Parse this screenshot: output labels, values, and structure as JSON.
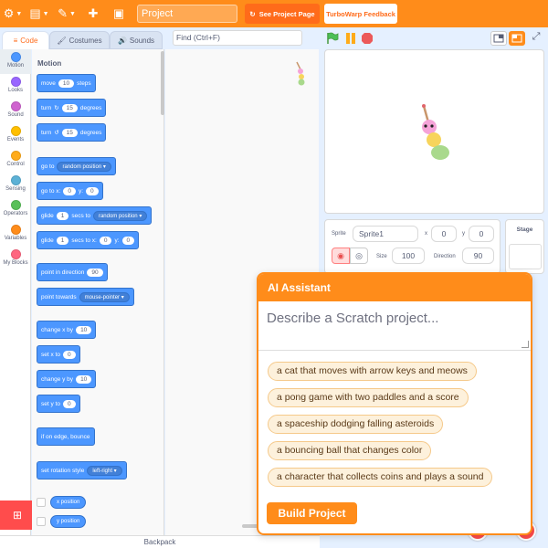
{
  "menubar": {
    "project_title": "Project",
    "see_project_label": "See Project Page",
    "feedback_label": "TurboWarp Feedback"
  },
  "tabs": {
    "code": "Code",
    "costumes": "Costumes",
    "sounds": "Sounds"
  },
  "find": {
    "placeholder": "Find (Ctrl+F)"
  },
  "categories": [
    {
      "label": "Motion",
      "color": "#4c97ff"
    },
    {
      "label": "Looks",
      "color": "#9966ff"
    },
    {
      "label": "Sound",
      "color": "#cf63cf"
    },
    {
      "label": "Events",
      "color": "#ffbf00"
    },
    {
      "label": "Control",
      "color": "#ffab19"
    },
    {
      "label": "Sensing",
      "color": "#5cb1d6"
    },
    {
      "label": "Operators",
      "color": "#59c059"
    },
    {
      "label": "Variables",
      "color": "#ff8c1a"
    },
    {
      "label": "My Blocks",
      "color": "#ff6680"
    }
  ],
  "palette": {
    "title": "Motion",
    "move": {
      "pre": "move",
      "val": "10",
      "post": "steps"
    },
    "turn_right": {
      "pre": "turn",
      "val": "15",
      "post": "degrees"
    },
    "turn_left": {
      "pre": "turn",
      "val": "15",
      "post": "degrees"
    },
    "goto": {
      "pre": "go to",
      "dd": "random position"
    },
    "goto_xy": {
      "pre": "go to x:",
      "x": "0",
      "mid": "y:",
      "y": "0"
    },
    "glide_to": {
      "pre": "glide",
      "val": "1",
      "mid": "secs to",
      "dd": "random position"
    },
    "glide_xy": {
      "pre": "glide",
      "val": "1",
      "mid": "secs to x:",
      "x": "0",
      "mid2": "y:",
      "y": "0"
    },
    "point_dir": {
      "pre": "point in direction",
      "val": "90"
    },
    "point_towards": {
      "pre": "point towards",
      "dd": "mouse-pointer"
    },
    "change_x": {
      "pre": "change x by",
      "val": "10"
    },
    "set_x": {
      "pre": "set x to",
      "val": "0"
    },
    "change_y": {
      "pre": "change y by",
      "val": "10"
    },
    "set_y": {
      "pre": "set y to",
      "val": "0"
    },
    "bounce": {
      "label": "if on edge, bounce"
    },
    "rot_style": {
      "pre": "set rotation style",
      "dd": "left-right"
    },
    "x_pos": "x position",
    "y_pos": "y position"
  },
  "backpack": "Backpack",
  "sprite_info": {
    "sprite_label": "Sprite",
    "sprite_name": "Sprite1",
    "x_label": "x",
    "x_value": "0",
    "y_label": "y",
    "y_value": "0",
    "size_label": "Size",
    "size_value": "100",
    "direction_label": "Direction",
    "direction_value": "90"
  },
  "stage_panel": {
    "label": "Stage"
  },
  "ai": {
    "title": "AI Assistant",
    "placeholder": "Describe a Scratch project...",
    "suggestions": [
      "a cat that moves with arrow keys and meows",
      "a pong game with two paddles and a score",
      "a spaceship dodging falling asteroids",
      "a bouncing ball that changes color",
      "a character that collects coins and plays a sound"
    ],
    "build_label": "Build Project"
  },
  "colors": {
    "accent": "#ff8c1a",
    "motion": "#4c97ff"
  }
}
